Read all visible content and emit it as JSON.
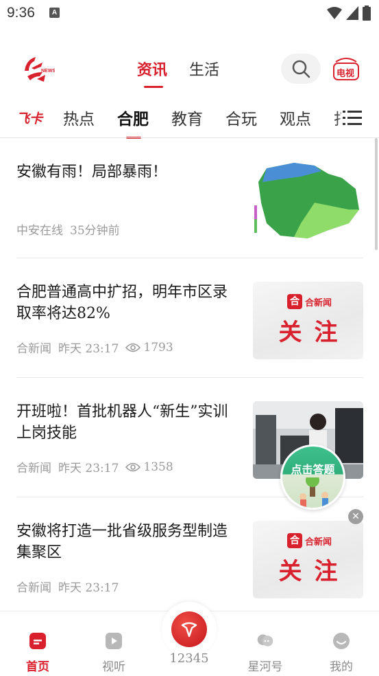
{
  "status_bar": {
    "time": "9:36",
    "notif_glyph": "A"
  },
  "header": {
    "tabs": [
      {
        "label": "资讯",
        "active": true
      },
      {
        "label": "生活",
        "active": false
      }
    ],
    "search_icon": "search-icon",
    "tv_label": "电视"
  },
  "channel_bar": {
    "promo": "飞卡",
    "channels": [
      {
        "label": "热点",
        "active": false
      },
      {
        "label": "合肥",
        "active": true
      },
      {
        "label": "教育",
        "active": false
      },
      {
        "label": "合玩",
        "active": false
      },
      {
        "label": "观点",
        "active": false
      },
      {
        "label": "打",
        "active": false
      }
    ],
    "menu_icon": "menu-icon"
  },
  "articles": [
    {
      "title": "安徽有雨！局部暴雨！",
      "source": "中安在线",
      "time": "35分钟前",
      "views": "",
      "thumb": "weather-map"
    },
    {
      "title": "合肥普通高中扩招，明年市区录取率将达82%",
      "source": "合新闻",
      "time": "昨天  23:17",
      "views": "1793",
      "thumb": "hefei-card"
    },
    {
      "title": "开班啦！首批机器人“新生”实训上岗技能",
      "source": "合新闻",
      "time": "昨天  23:17",
      "views": "1358",
      "thumb": "robot-lab"
    },
    {
      "title": "安徽将打造一批省级服务型制造集聚区",
      "source": "合新闻",
      "time": "昨天  23:17",
      "views": "",
      "thumb": "hefei-card"
    }
  ],
  "hefei_card": {
    "logo_text": "合新闻",
    "big_text": "关注"
  },
  "quiz_badge": {
    "label": "点击答题"
  },
  "bottom_nav": {
    "items": [
      {
        "label": "首页",
        "active": true
      },
      {
        "label": "视听",
        "active": false
      },
      {
        "label": "12345",
        "active": false
      },
      {
        "label": "星河号",
        "active": false
      },
      {
        "label": "我的",
        "active": false
      }
    ]
  },
  "colors": {
    "accent": "#d9212e",
    "text": "#1a1a1a",
    "meta": "#9a9a9a",
    "green": "#2fae7a"
  }
}
